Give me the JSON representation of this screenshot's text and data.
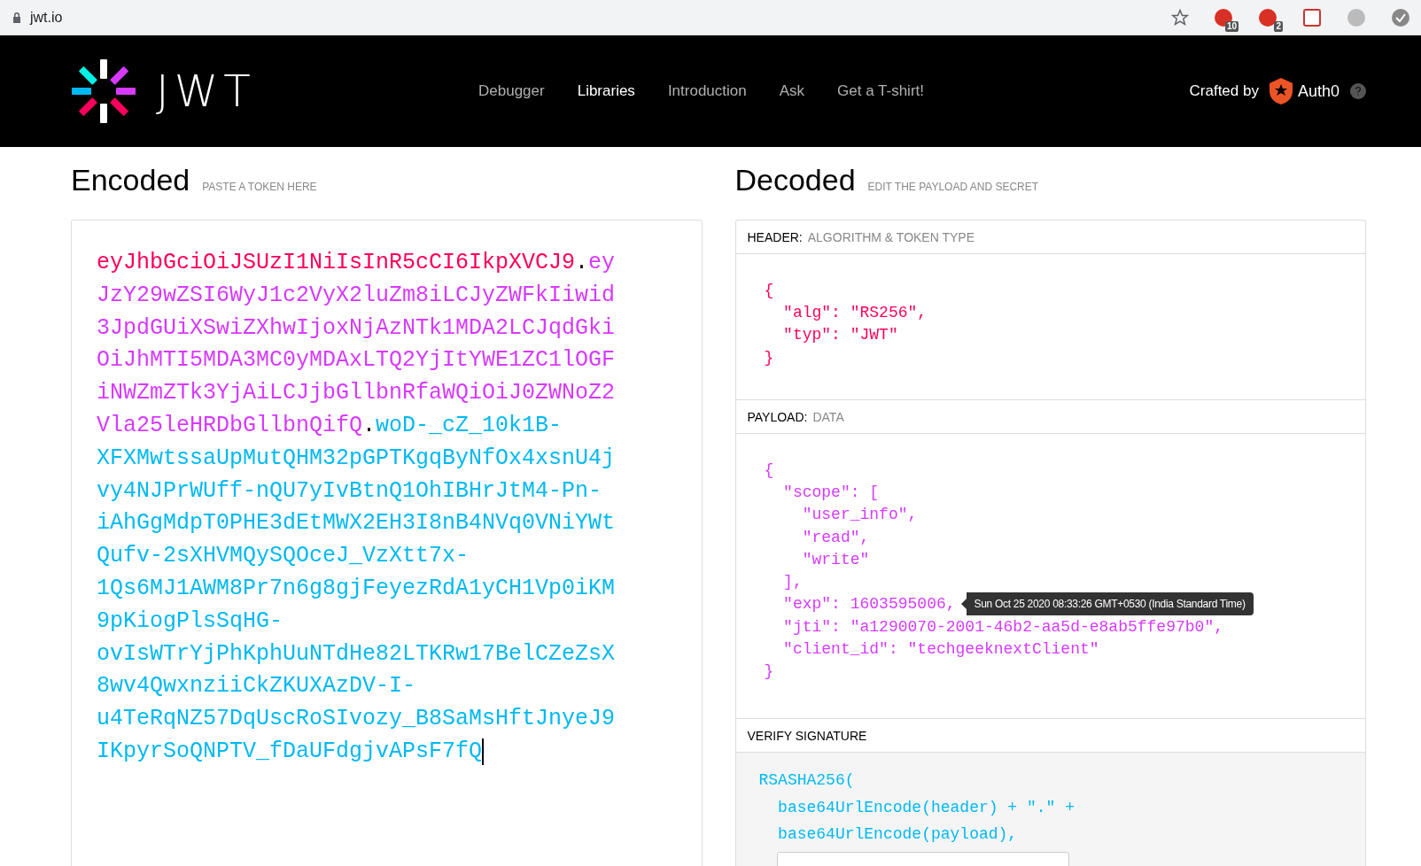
{
  "browser": {
    "address": "jwt.io",
    "extensions": [
      {
        "kind": "counter",
        "badge": "10"
      },
      {
        "kind": "counter",
        "badge": "2"
      },
      {
        "kind": "calendar"
      },
      {
        "kind": "profile"
      },
      {
        "kind": "check"
      }
    ]
  },
  "header": {
    "logo_text": "JWT",
    "nav": [
      {
        "label": "Debugger",
        "selected": false
      },
      {
        "label": "Libraries",
        "selected": true
      },
      {
        "label": "Introduction",
        "selected": false
      },
      {
        "label": "Ask",
        "selected": false
      },
      {
        "label": "Get a T-shirt!",
        "selected": false
      }
    ],
    "crafted_by": "Crafted by",
    "brand": "Auth0"
  },
  "encoded": {
    "title": "Encoded",
    "subtitle": "PASTE A TOKEN HERE",
    "token_lines": [
      [
        {
          "kind": "header",
          "text": "eyJhbGciOiJSUzI1NiIsInR5cCI6IkpXVCJ9"
        },
        {
          "kind": "dot",
          "text": "."
        },
        {
          "kind": "payload",
          "text": "ey"
        }
      ],
      [
        {
          "kind": "payload",
          "text": "JzY29wZSI6WyJ1c2VyX2luZm8iLCJyZWFkIiwid"
        }
      ],
      [
        {
          "kind": "payload",
          "text": "3JpdGUiXSwiZXhwIjoxNjAzNTk1MDA2LCJqdGki"
        }
      ],
      [
        {
          "kind": "payload",
          "text": "OiJhMTI5MDA3MC0yMDAxLTQ2YjItYWE1ZC1lOGF"
        }
      ],
      [
        {
          "kind": "payload",
          "text": "iNWZmZTk3YjAiLCJjbGllbnRfaWQiOiJ0ZWNoZ2"
        }
      ],
      [
        {
          "kind": "payload",
          "text": "Vla25leHRDbGllbnQifQ"
        },
        {
          "kind": "dot",
          "text": "."
        },
        {
          "kind": "signature",
          "text": "woD-_cZ_10k1B-"
        }
      ],
      [
        {
          "kind": "signature",
          "text": "XFXMwtssaUpMutQHM32pGPTKgqByNfOx4xsnU4j"
        }
      ],
      [
        {
          "kind": "signature",
          "text": "vy4NJPrWUff-nQU7yIvBtnQ1OhIBHrJtM4-Pn-"
        }
      ],
      [
        {
          "kind": "signature",
          "text": "iAhGgMdpT0PHE3dEtMWX2EH3I8nB4NVq0VNiYWt"
        }
      ],
      [
        {
          "kind": "signature",
          "text": "Qufv-2sXHVMQySQOceJ_VzXtt7x-"
        }
      ],
      [
        {
          "kind": "signature",
          "text": "1Qs6MJ1AWM8Pr7n6g8gjFeyezRdA1yCH1Vp0iKM"
        }
      ],
      [
        {
          "kind": "signature",
          "text": "9pKiogPlsSqHG-"
        }
      ],
      [
        {
          "kind": "signature",
          "text": "ovIsWTrYjPhKphUuNTdHe82LTKRw17BelCZeZsX"
        }
      ],
      [
        {
          "kind": "signature",
          "text": "8wv4QwxnziiCkZKUXAzDV-I-"
        }
      ],
      [
        {
          "kind": "signature",
          "text": "u4TeRqNZ57DqUscRoSIvozy_B8SaMsHftJnyeJ9"
        }
      ],
      [
        {
          "kind": "signature",
          "text": "IKpyrSoQNPTV_fDaUFdgjvAPsF7fQ"
        }
      ]
    ]
  },
  "decoded": {
    "title": "Decoded",
    "subtitle": "EDIT THE PAYLOAD AND SECRET",
    "sections": [
      {
        "kind": "header",
        "label": "HEADER:",
        "sublabel": "ALGORITHM & TOKEN TYPE",
        "lines": [
          {
            "text": "{"
          },
          {
            "text": "  \"alg\": \"RS256\","
          },
          {
            "text": "  \"typ\": \"JWT\""
          },
          {
            "text": "}"
          }
        ]
      },
      {
        "kind": "payload",
        "label": "PAYLOAD:",
        "sublabel": "DATA",
        "lines": [
          {
            "text": "{"
          },
          {
            "text": "  \"scope\": ["
          },
          {
            "text": "    \"user_info\","
          },
          {
            "text": "    \"read\","
          },
          {
            "text": "    \"write\""
          },
          {
            "text": "  ],"
          },
          {
            "text": "  \"exp\": 1603595006,",
            "tooltip": "Sun Oct 25 2020 08:33:26 GMT+0530 (India Standard Time)"
          },
          {
            "text": "  \"jti\": \"a1290070-2001-46b2-aa5d-e8ab5ffe97b0\","
          },
          {
            "text": "  \"client_id\": \"techgeeknextClient\""
          },
          {
            "text": "}"
          }
        ]
      },
      {
        "kind": "signature",
        "label": "VERIFY SIGNATURE",
        "lines": [
          {
            "text": "RSASHA256("
          },
          {
            "text": "  base64UrlEncode(header) + \".\" +"
          },
          {
            "text": "  base64UrlEncode(payload),"
          }
        ]
      }
    ]
  }
}
